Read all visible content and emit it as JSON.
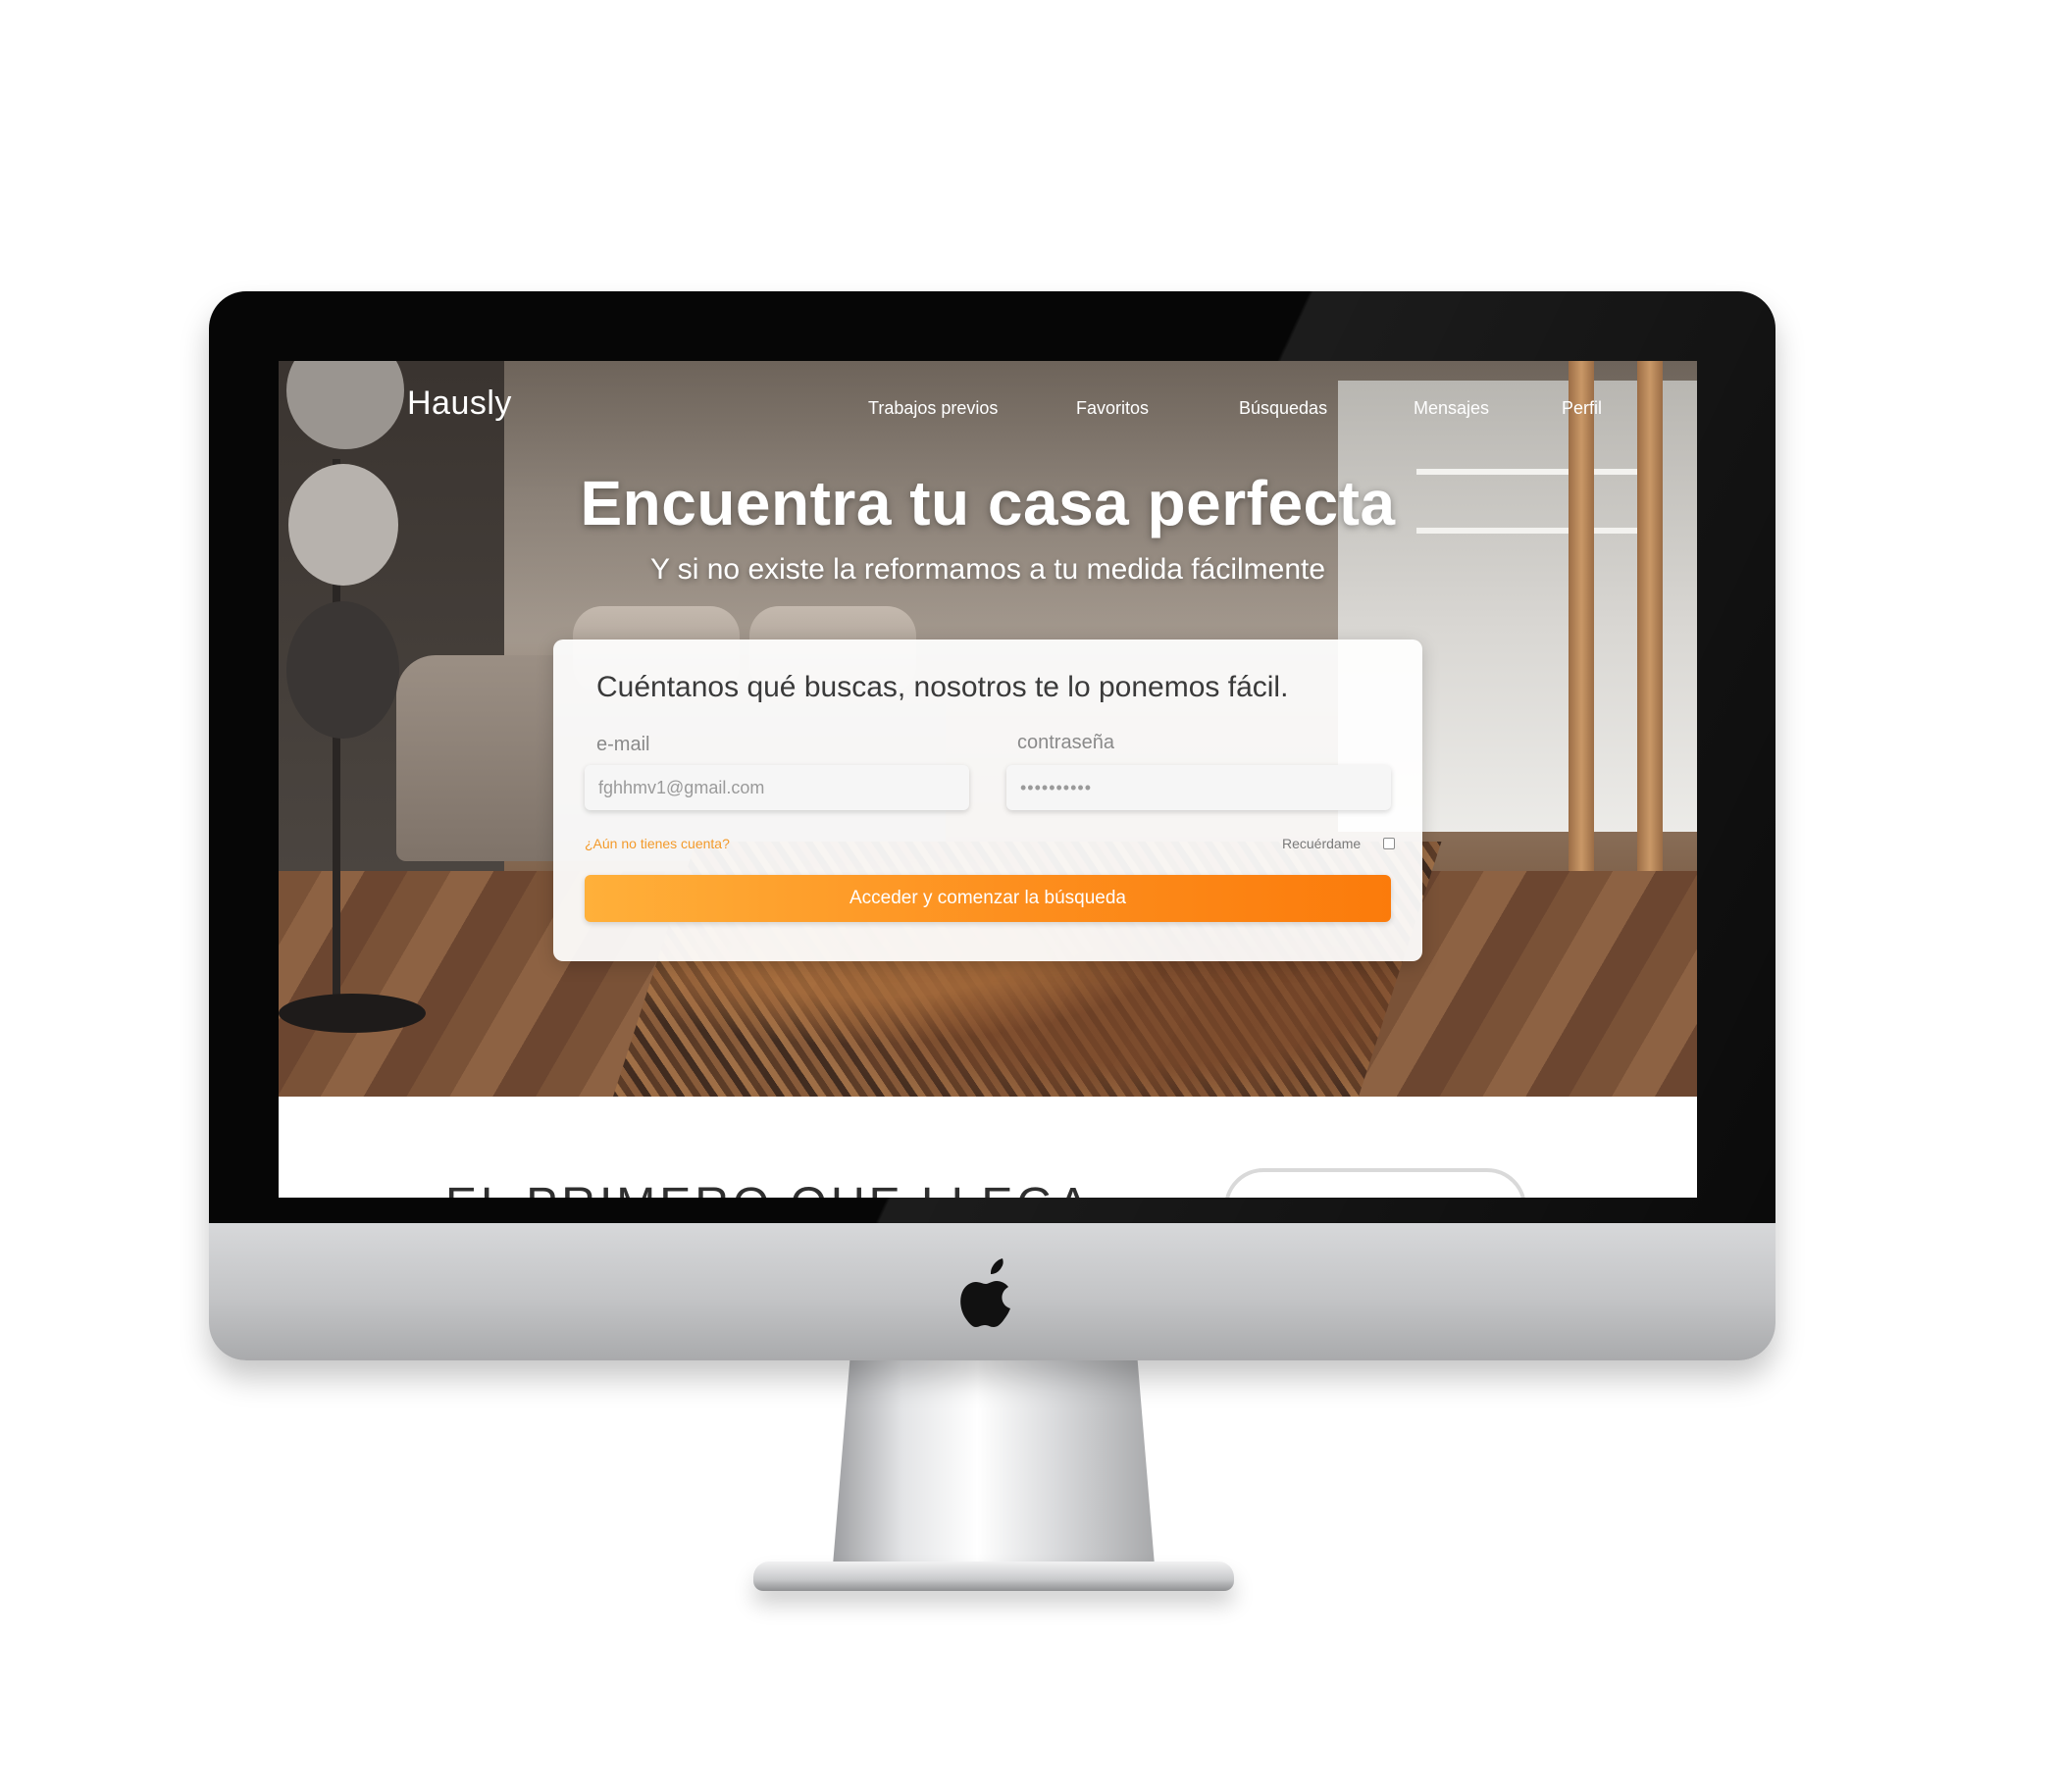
{
  "header": {
    "brand": "Hausly",
    "nav": [
      "Trabajos previos",
      "Favoritos",
      "Búsquedas",
      "Mensajes",
      "Perfil"
    ]
  },
  "hero": {
    "title": "Encuentra tu casa perfecta",
    "subtitle": "Y si no existe la reformamos a tu medida fácilmente"
  },
  "login_card": {
    "title": "Cuéntanos qué buscas, nosotros te lo ponemos fácil.",
    "email_label": "e-mail",
    "email_value": "fghhmv1@gmail.com",
    "password_label": "contraseña",
    "password_value": "••••••••••",
    "signup_link": "¿Aún no tienes cuenta?",
    "remember_label": "Recuérdame",
    "remember_checked": false,
    "submit_label": "Acceder y comenzar la búsqueda"
  },
  "next_section": {
    "heading": "EL PRIMERO QUE LLEGA"
  },
  "colors": {
    "accent": "#fd8e1d",
    "link": "#f39a2b"
  },
  "icons": {
    "device_logo": "apple-icon"
  }
}
